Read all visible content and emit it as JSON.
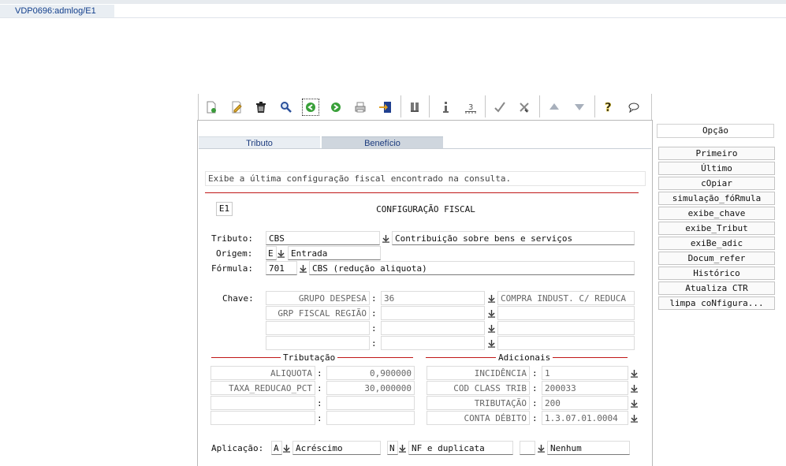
{
  "window": {
    "tab_title": "VDP0696:admlog/E1"
  },
  "toolbar": {
    "icons": [
      "new-icon",
      "edit-icon",
      "delete-icon",
      "search-icon",
      "prev-icon",
      "next-icon",
      "print-icon",
      "export-icon",
      "sort-icon",
      "info-icon",
      "count-icon",
      "confirm-icon",
      "cancel-icon",
      "up-icon",
      "down-icon",
      "help-icon",
      "chat-icon"
    ]
  },
  "tabs": [
    {
      "label": "Tributo"
    },
    {
      "label": "Benefício"
    }
  ],
  "message": "Exibe a última configuração fiscal encontrado na consulta.",
  "header": {
    "code": "E1",
    "title": "CONFIGURAÇÃO FISCAL"
  },
  "form": {
    "tributo": {
      "label": "Tributo:",
      "code": "CBS",
      "desc": "Contribuição sobre bens e serviços"
    },
    "origem": {
      "label": "Origem:",
      "code": "E",
      "desc": "Entrada"
    },
    "formula": {
      "label": "Fórmula:",
      "code": "701",
      "desc": "CBS (redução aliquota)"
    },
    "chave": {
      "label": "Chave:",
      "rows": [
        {
          "name": "GRUPO DESPESA",
          "sep": ":",
          "value": "36",
          "desc": "COMPRA INDUST. C/ REDUCA"
        },
        {
          "name": "GRP FISCAL REGIÃO",
          "sep": ":",
          "value": "",
          "desc": ""
        },
        {
          "name": "",
          "sep": ":",
          "value": "",
          "desc": ""
        },
        {
          "name": "",
          "sep": ":",
          "value": "",
          "desc": ""
        }
      ]
    },
    "tributacao": {
      "title": "Tributação",
      "rows": [
        {
          "name": "ALIQUOTA",
          "sep": ":",
          "value": "0,900000"
        },
        {
          "name": "TAXA_REDUCAO_PCT",
          "sep": ":",
          "value": "30,000000"
        },
        {
          "name": "",
          "sep": ":",
          "value": ""
        },
        {
          "name": "",
          "sep": ":",
          "value": ""
        }
      ]
    },
    "adicionais": {
      "title": "Adicionais",
      "rows": [
        {
          "name": "INCIDÊNCIA",
          "sep": ":",
          "value": "1"
        },
        {
          "name": "COD CLASS TRIB",
          "sep": ":",
          "value": "200033"
        },
        {
          "name": "TRIBUTAÇÃO",
          "sep": ":",
          "value": "200"
        },
        {
          "name": "CONTA DÉBITO",
          "sep": ":",
          "value": "1.3.07.01.0004"
        }
      ]
    },
    "aplicacao": {
      "label": "Aplicação:",
      "a_code": "A",
      "a_desc": "Acréscimo",
      "n_code": "N",
      "n_desc": "NF e duplicata",
      "x_code": "",
      "x_desc": "Nenhum"
    }
  },
  "side": {
    "title": "Opção",
    "buttons": [
      "Primeiro",
      "Último",
      "cOpiar",
      "simulação_fóRmula",
      "exibe_chave",
      "exibe_Tribut",
      "exiBe_adic",
      "Docum_refer",
      "Histórico",
      "Atualiza CTR",
      "limpa coNfigura..."
    ]
  },
  "colors": {
    "accent_red": "#c01818",
    "tab_text": "#1c3b7e",
    "window_tab_text": "#123f8c"
  }
}
